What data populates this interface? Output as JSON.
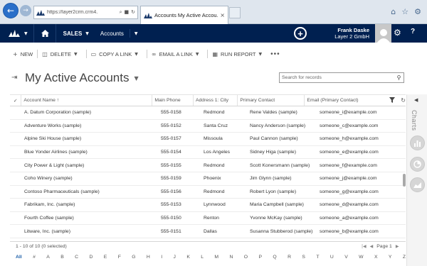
{
  "browser": {
    "url": "https://layer2crm.crm4.",
    "tab_title": "Accounts My Active Accou...",
    "tab_close": "×"
  },
  "topnav": {
    "area": "SALES",
    "entity": "Accounts",
    "user_name": "Frank Daske",
    "org_name": "Layer 2 GmbH",
    "help": "?"
  },
  "commands": {
    "new": "NEW",
    "delete": "DELETE",
    "copy_link": "COPY A LINK",
    "email_link": "EMAIL A LINK",
    "run_report": "RUN REPORT",
    "more": "•••"
  },
  "view": {
    "title": "My Active Accounts"
  },
  "search": {
    "placeholder": "Search for records"
  },
  "grid": {
    "columns": [
      "Account Name ↑",
      "Main Phone",
      "Address 1: City",
      "Primary Contact",
      "Email (Primary Contact)"
    ],
    "rows": [
      {
        "name": "A. Datum Corporation (sample)",
        "phone": "555-0158",
        "city": "Redmond",
        "contact": "Rene Valdes (sample)",
        "email": "someone_i@example.com"
      },
      {
        "name": "Adventure Works (sample)",
        "phone": "555-0152",
        "city": "Santa Cruz",
        "contact": "Nancy Anderson (sample)",
        "email": "someone_c@example.com"
      },
      {
        "name": "Alpine Ski House (sample)",
        "phone": "555-0157",
        "city": "Missoula",
        "contact": "Paul Cannon (sample)",
        "email": "someone_h@example.com"
      },
      {
        "name": "Blue Yonder Airlines (sample)",
        "phone": "555-0154",
        "city": "Los Angeles",
        "contact": "Sidney Higa (sample)",
        "email": "someone_e@example.com"
      },
      {
        "name": "City Power & Light (sample)",
        "phone": "555-0155",
        "city": "Redmond",
        "contact": "Scott Konersmann (sample)",
        "email": "someone_f@example.com"
      },
      {
        "name": "Coho Winery (sample)",
        "phone": "555-0159",
        "city": "Phoenix",
        "contact": "Jim Glynn (sample)",
        "email": "someone_j@example.com"
      },
      {
        "name": "Contoso Pharmaceuticals (sample)",
        "phone": "555-0156",
        "city": "Redmond",
        "contact": "Robert Lyon (sample)",
        "email": "someone_g@example.com"
      },
      {
        "name": "Fabrikam, Inc. (sample)",
        "phone": "555-0153",
        "city": "Lynnwood",
        "contact": "Maria Campbell (sample)",
        "email": "someone_d@example.com"
      },
      {
        "name": "Fourth Coffee (sample)",
        "phone": "555-0150",
        "city": "Renton",
        "contact": "Yvonne McKay (sample)",
        "email": "someone_a@example.com"
      },
      {
        "name": "Litware, Inc. (sample)",
        "phone": "555-0151",
        "city": "Dallas",
        "contact": "Susanna Stubberod (sample)",
        "email": "someone_b@example.com"
      }
    ]
  },
  "footer": {
    "record_count": "1 - 10 of 10 (0 selected)",
    "page": "Page 1",
    "letters": [
      "All",
      "#",
      "A",
      "B",
      "C",
      "D",
      "E",
      "F",
      "G",
      "H",
      "I",
      "J",
      "K",
      "L",
      "M",
      "N",
      "O",
      "P",
      "Q",
      "R",
      "S",
      "T",
      "U",
      "V",
      "W",
      "X",
      "Y",
      "Z"
    ]
  },
  "side_pane": {
    "label": "Charts"
  },
  "colors": {
    "topnav_bg": "#002050",
    "link_blue": "#1a5ea8"
  }
}
